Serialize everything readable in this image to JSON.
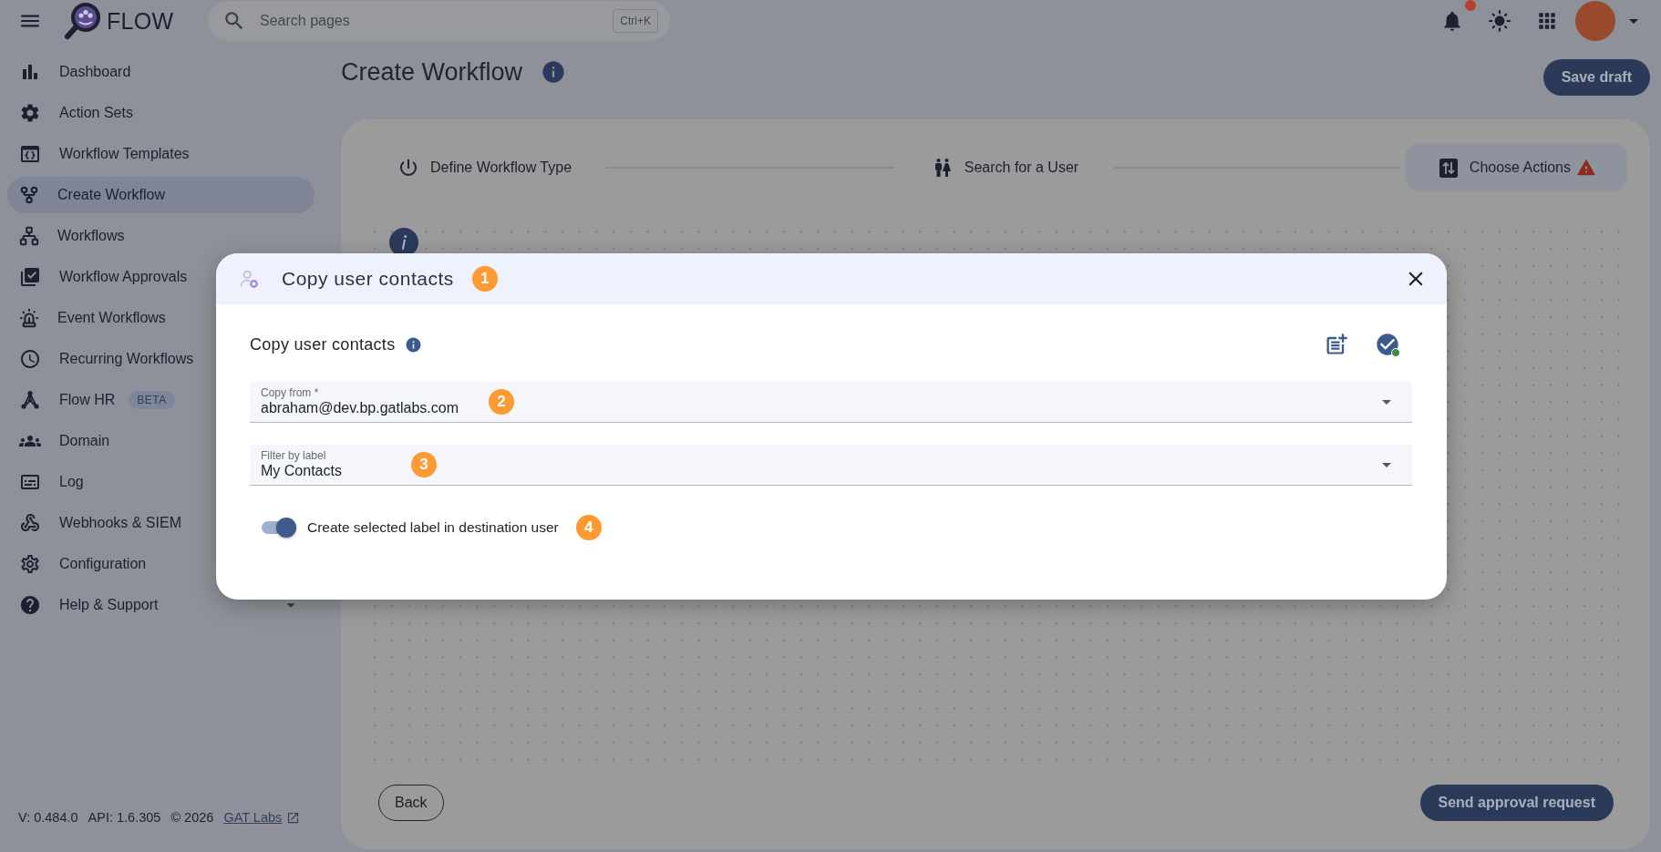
{
  "header": {
    "app_name": "FLOW",
    "search": {
      "placeholder": "Search pages",
      "shortcut": "Ctrl+K"
    },
    "notifications": {
      "unread": true
    }
  },
  "sidebar": {
    "items": [
      {
        "label": "Dashboard",
        "selected": false
      },
      {
        "label": "Action Sets",
        "selected": false
      },
      {
        "label": "Workflow Templates",
        "selected": false
      },
      {
        "label": "Create Workflow",
        "selected": true
      },
      {
        "label": "Workflows",
        "selected": false
      },
      {
        "label": "Workflow Approvals",
        "selected": false
      },
      {
        "label": "Event Workflows",
        "selected": false
      },
      {
        "label": "Recurring Workflows",
        "selected": false
      },
      {
        "label": "Flow HR",
        "badge": "BETA",
        "selected": false
      },
      {
        "label": "Domain",
        "selected": false
      },
      {
        "label": "Log",
        "selected": false
      },
      {
        "label": "Webhooks & SIEM",
        "selected": false
      },
      {
        "label": "Configuration",
        "selected": false
      },
      {
        "label": "Help & Support",
        "selected": false,
        "expanded": false
      }
    ],
    "footer": {
      "version": "V: 0.484.0",
      "api": "API: 1.6.305",
      "copyright": "© 2026",
      "link": "GAT Labs"
    }
  },
  "page": {
    "title": "Create Workflow",
    "save_button": "Save draft",
    "steps": [
      {
        "label": "Define Workflow Type",
        "selected": false,
        "warning": false
      },
      {
        "label": "Search for a User",
        "selected": false,
        "warning": false
      },
      {
        "label": "Choose Actions",
        "selected": true,
        "warning": true
      }
    ],
    "back_button": "Back",
    "submit_button": "Send approval request"
  },
  "dialog": {
    "title": "Copy user contacts",
    "marker": "1",
    "section_title": "Copy user contacts",
    "fields": [
      {
        "label": "Copy from *",
        "value": "abraham@dev.bp.gatlabs.com",
        "marker": "2"
      },
      {
        "label": "Filter by label",
        "value": "My Contacts",
        "marker": "3"
      }
    ],
    "toggle": {
      "label": "Create selected label in destination user",
      "on": true,
      "marker": "4"
    }
  }
}
